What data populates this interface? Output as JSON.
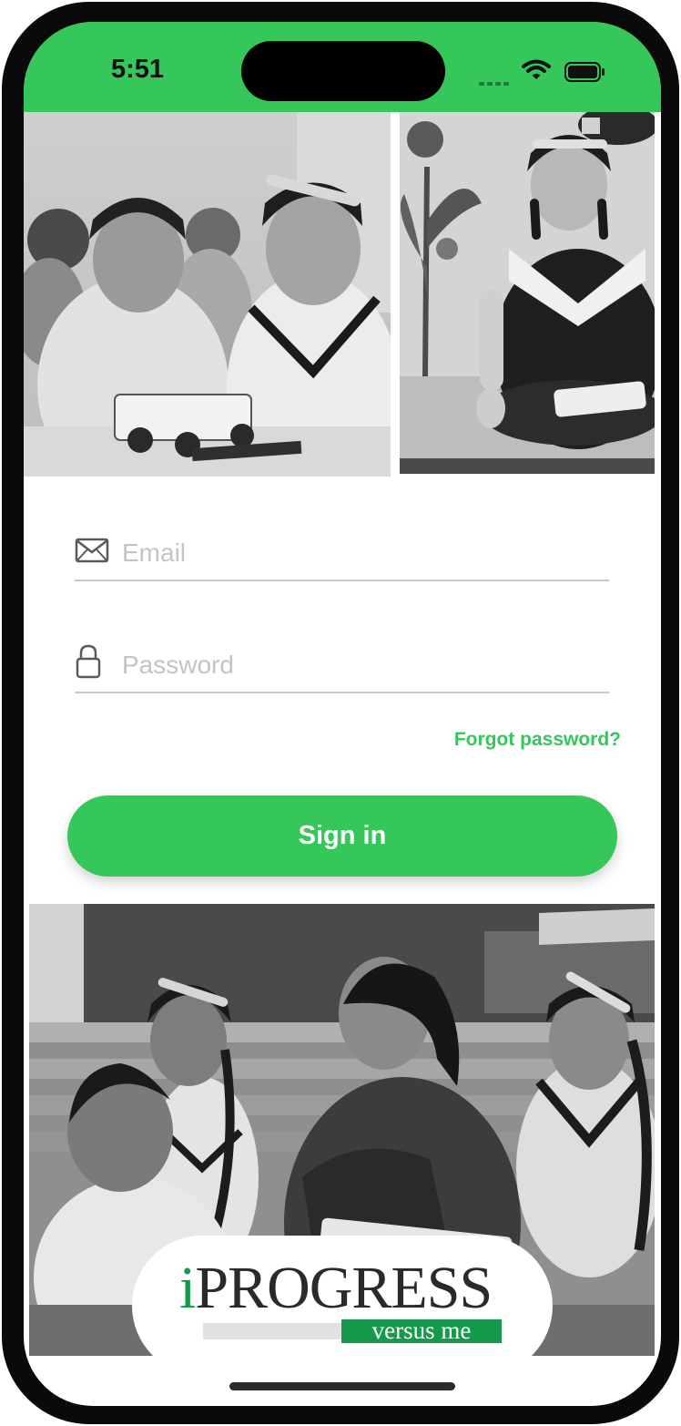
{
  "status_bar": {
    "time": "5:51",
    "background_color": "#35c759"
  },
  "photos": {
    "top_left": "students-with-robot-photo",
    "top_right": "student-meditating-photo",
    "bottom": "teacher-with-students-photo"
  },
  "login_form": {
    "email_placeholder": "Email",
    "password_placeholder": "Password",
    "forgot_password_label": "Forgot password?",
    "sign_in_label": "Sign in",
    "accent_color": "#35c759"
  },
  "logo": {
    "title_i": "i",
    "title_rest": "PROGRESS",
    "tagline": "versus me",
    "brand_green": "#149a4a"
  }
}
